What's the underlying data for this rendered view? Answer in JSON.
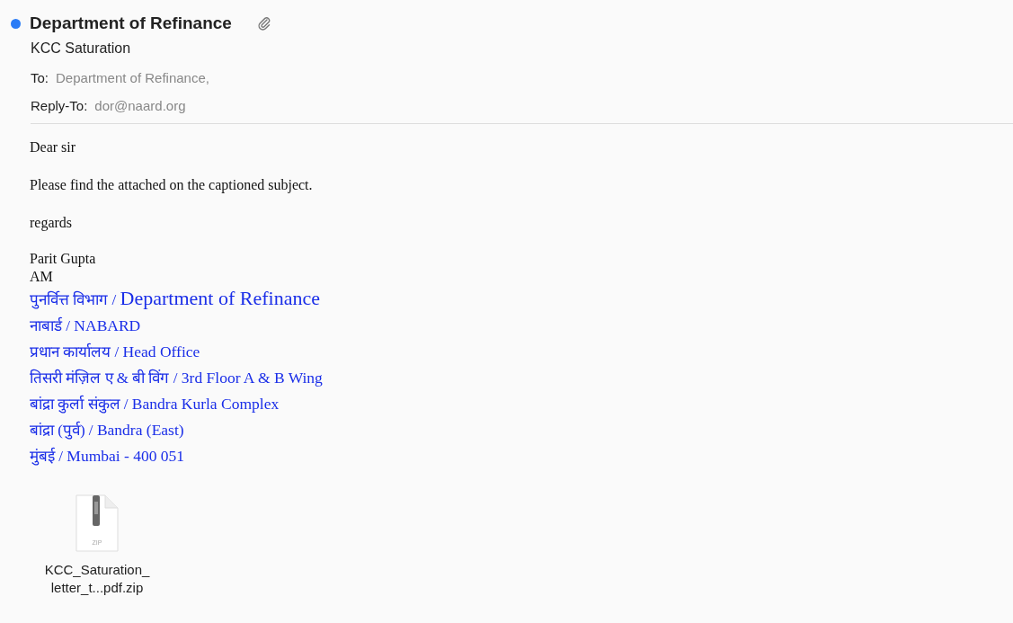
{
  "message": {
    "unread": true,
    "sender": "Department of Refinance",
    "has_attachment": true,
    "subject": "KCC Saturation",
    "to": {
      "label": "To:",
      "value": "Department of Refinance,"
    },
    "reply_to": {
      "label": "Reply-To:",
      "value": "dor@naard.org"
    }
  },
  "body": {
    "paragraphs": [
      "Dear sir",
      "Please find the attached on the captioned subject.",
      "regards"
    ],
    "signature_name": [
      "Parit Gupta",
      "AM"
    ],
    "signature_lines": [
      {
        "kind": "heading",
        "local": "पुनर्वित्त विभाग /",
        "english": "Department of Refinance"
      },
      {
        "kind": "normal",
        "local": "नाबार्ड /",
        "english": "NABARD"
      },
      {
        "kind": "normal",
        "local": "प्रधान कार्यालय /",
        "english": "Head Office"
      },
      {
        "kind": "normal",
        "local": "तिसरी मंज़िल ए & बी विंग /",
        "english": "3rd Floor A & B Wing"
      },
      {
        "kind": "normal",
        "local": "बांद्रा कुर्ला संकुल /",
        "english": "Bandra Kurla Complex"
      },
      {
        "kind": "normal",
        "local": "बांद्रा (पुर्व) /",
        "english": "Bandra (East)"
      },
      {
        "kind": "normal",
        "local": "मुंबई /",
        "english": "Mumbai - 400 051"
      }
    ]
  },
  "attachment": {
    "type_label": "ZIP",
    "name_lines": [
      "KCC_Saturation_",
      "letter_t...pdf.zip"
    ]
  }
}
